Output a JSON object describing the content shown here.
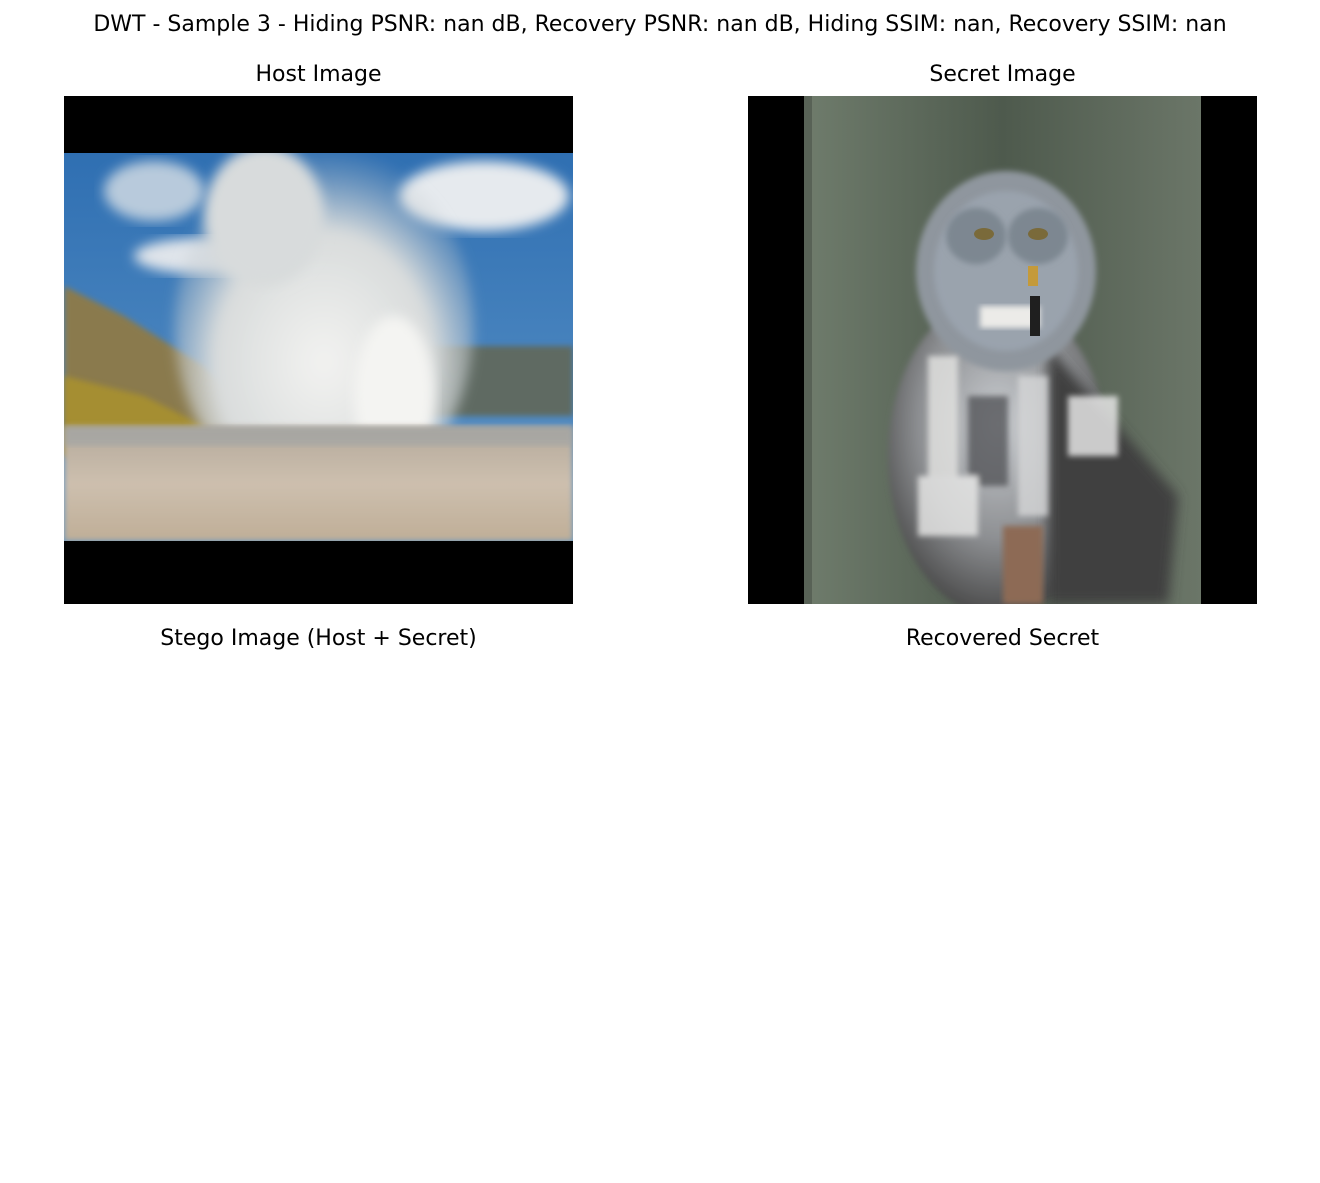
{
  "figure": {
    "title": "DWT - Sample 3 - Hiding PSNR: nan dB, Recovery PSNR: nan dB, Hiding SSIM: nan, Recovery SSIM: nan"
  },
  "panels": [
    {
      "title": "Host Image",
      "content": "landscape photo of a geyser steam plume under a blue sky, letterboxed with black bars"
    },
    {
      "title": "Secret Image",
      "content": "photo of a great grey owl, pillarboxed with black bars"
    },
    {
      "title": "Stego Image (Host + Secret)",
      "content": ""
    },
    {
      "title": "Recovered Secret",
      "content": ""
    }
  ]
}
